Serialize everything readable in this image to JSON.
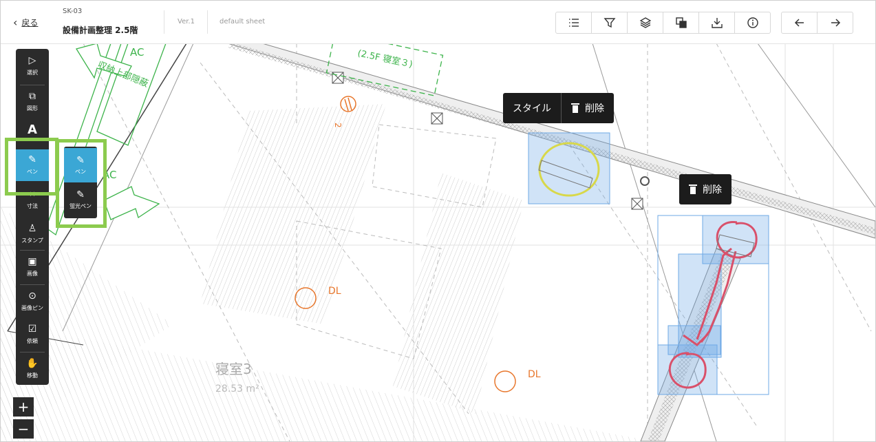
{
  "header": {
    "back_label": "戻る",
    "doc_id": "SK-03",
    "doc_title": "設備計画整理 2.5階",
    "version": "Ver.1",
    "sheet": "default sheet"
  },
  "toolbar_icons": [
    "list-icon",
    "filter-icon",
    "layers-icon",
    "copy-icon",
    "download-icon",
    "info-icon"
  ],
  "nav_icons": [
    "arrow-left-icon",
    "arrow-right-icon"
  ],
  "left_tools": [
    {
      "name": "select",
      "icon": "▷",
      "label": "選択"
    },
    {
      "name": "shape",
      "icon": "⧉",
      "label": "図形"
    },
    {
      "name": "text",
      "icon": "A",
      "label": ""
    },
    {
      "name": "pen",
      "icon": "✎",
      "label": "ペン",
      "active": true
    },
    {
      "name": "dimension",
      "icon": "↔",
      "label": "寸法"
    },
    {
      "name": "stamp",
      "icon": "♙",
      "label": "スタンプ"
    },
    {
      "name": "image",
      "icon": "▣",
      "label": "画像"
    },
    {
      "name": "image-pin",
      "icon": "⊙",
      "label": "画像ピン"
    },
    {
      "name": "request",
      "icon": "☑",
      "label": "依頼"
    },
    {
      "name": "move",
      "icon": "✋",
      "label": "移動"
    }
  ],
  "sub_tools": [
    {
      "name": "pen",
      "icon": "✎",
      "label": "ペン",
      "active": true
    },
    {
      "name": "highlighter",
      "icon": "✎",
      "label": "蛍光ペン"
    }
  ],
  "zoom": {
    "in": "+",
    "out": "−"
  },
  "popup_style": {
    "style_label": "スタイル",
    "delete_label": "削除"
  },
  "popup_delete": {
    "delete_label": "削除"
  },
  "plan": {
    "room_name": "寝室3",
    "room_area": "28.53 m²",
    "dl_labels": [
      "DL",
      "DL"
    ],
    "ac_labels": [
      "AC",
      "収納上部隠蔽",
      "AC",
      "(2.5F 寝室３)"
    ]
  },
  "colors": {
    "accent": "#3ba7d5",
    "highlight_box": "#8ccb4e",
    "annotation_red": "#d9506a",
    "annotation_yellow": "#d8d84a",
    "plan_green": "#3cb34a",
    "plan_orange": "#e8762b"
  }
}
